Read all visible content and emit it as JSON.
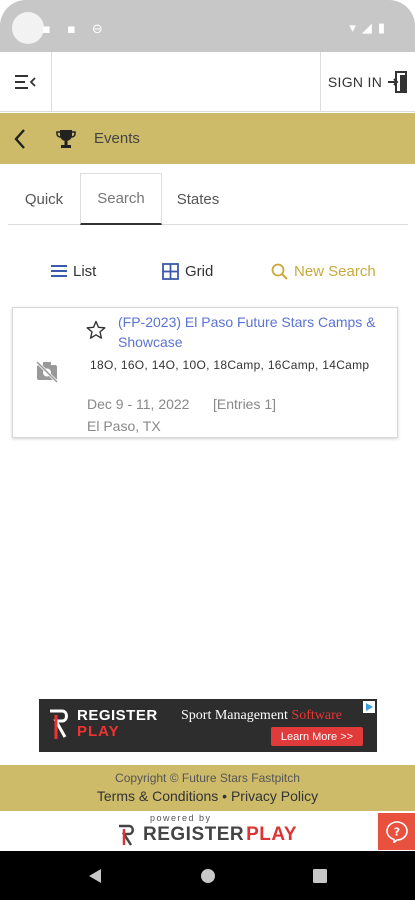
{
  "status_bar": {
    "left_icons": "▪ ▪ ⊖",
    "right_icons": "▾◢▮"
  },
  "header": {
    "signin_label": "SIGN IN"
  },
  "title_bar": {
    "title": "Events"
  },
  "tabs": [
    {
      "label": "Quick",
      "active": false
    },
    {
      "label": "Search",
      "active": true
    },
    {
      "label": "States",
      "active": false
    }
  ],
  "view_options": {
    "list_label": "List",
    "grid_label": "Grid",
    "new_search_label": "New Search"
  },
  "event": {
    "title": "(FP-2023) El Paso Future Stars Camps & Showcase",
    "divisions": "18O, 16O, 14O, 10O, 18Camp, 16Camp, 14Camp",
    "dates": "Dec 9 - 11, 2022",
    "entries": "[Entries 1]",
    "location": "El Paso, TX"
  },
  "ad": {
    "brand_word1": "REGISTER",
    "brand_word2": "PLAY",
    "tagline": "Sport Management",
    "tagline_highlight": "Software",
    "cta": "Learn More >>"
  },
  "footer": {
    "copyright": "Copyright © Future Stars Fastpitch",
    "terms": "Terms & Conditions",
    "separator": "•",
    "privacy": "Privacy Policy",
    "powered_by": "powered by",
    "brand_word1": "REGISTER",
    "brand_word2": "PLAY"
  },
  "colors": {
    "gold": "#cdbb6a",
    "link_blue": "#5b73d1",
    "accent_gold": "#c9a93c",
    "red": "#e03a3a"
  },
  "icons": {
    "menu": "menu-collapse-icon",
    "signin": "sign-in-door-icon",
    "back": "chevron-left-icon",
    "trophy": "trophy-icon",
    "list": "list-icon",
    "grid": "grid-icon",
    "search": "search-icon",
    "noimage": "no-image-icon",
    "star": "star-outline-icon",
    "help": "help-icon"
  }
}
